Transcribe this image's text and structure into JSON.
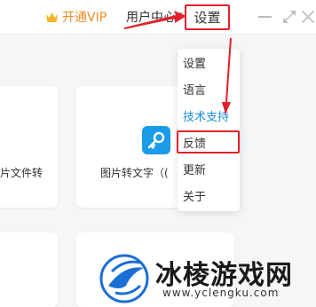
{
  "titlebar": {
    "vip_label": "开通VIP",
    "user_center_label": "用户中心",
    "settings_label": "设置"
  },
  "cards": {
    "card1_label": "片文件转",
    "card2_label": "图片转文字（("
  },
  "settings_menu": {
    "items": [
      {
        "label": "设置"
      },
      {
        "label": "语言"
      },
      {
        "label": "技术支持"
      },
      {
        "label": "反馈"
      },
      {
        "label": "更新"
      },
      {
        "label": "关于"
      }
    ]
  },
  "watermark": {
    "title": "冰棱游戏网",
    "url": "www.yclengku.com"
  },
  "colors": {
    "accent_blue": "#1a9ce9",
    "highlight_red": "#e3202a",
    "vip_orange": "#f08a24"
  }
}
